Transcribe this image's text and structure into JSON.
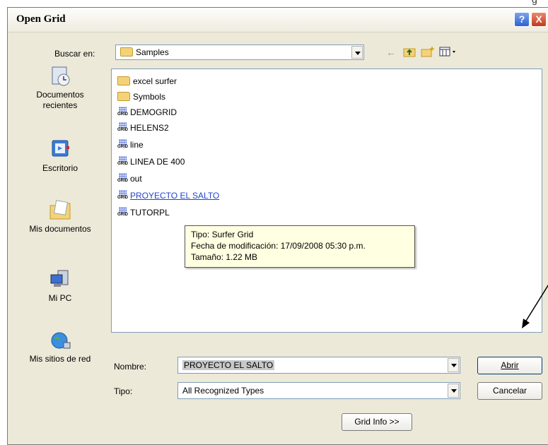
{
  "page_corner_text": "g",
  "window": {
    "title": "Open Grid",
    "help_label": "?",
    "close_label": "X"
  },
  "look_in": {
    "label": "Buscar en:",
    "value": "Samples"
  },
  "toolbar": {
    "icons": [
      "back-arrow-icon",
      "up-folder-icon",
      "new-folder-icon",
      "view-menu-icon"
    ]
  },
  "places": [
    {
      "label": "Documentos recientes",
      "icon": "recent-documents-icon"
    },
    {
      "label": "Escritorio",
      "icon": "desktop-icon"
    },
    {
      "label": "Mis documentos",
      "icon": "my-documents-icon"
    },
    {
      "label": "Mi PC",
      "icon": "my-computer-icon"
    },
    {
      "label": "Mis sitios de red",
      "icon": "network-places-icon"
    }
  ],
  "files": [
    {
      "name": "excel surfer",
      "type": "folder"
    },
    {
      "name": "Symbols",
      "type": "folder"
    },
    {
      "name": "DEMOGRID",
      "type": "grid"
    },
    {
      "name": "HELENS2",
      "type": "grid"
    },
    {
      "name": "line",
      "type": "grid"
    },
    {
      "name": "LINEA DE 400",
      "type": "grid"
    },
    {
      "name": "out",
      "type": "grid"
    },
    {
      "name": "PROYECTO EL SALTO",
      "type": "grid",
      "selected": true
    },
    {
      "name": "TUTORPL",
      "type": "grid"
    }
  ],
  "grid_icon_text": "GRID",
  "tooltip": {
    "line1": "Tipo: Surfer Grid",
    "line2": "Fecha de modificación: 17/09/2008 05:30 p.m.",
    "line3": "Tamaño: 1.22 MB"
  },
  "filename": {
    "label": "Nombre:",
    "value": "PROYECTO EL SALTO"
  },
  "filetype": {
    "label": "Tipo:",
    "value": "All Recognized Types"
  },
  "buttons": {
    "open": "Abrir",
    "cancel": "Cancelar",
    "grid_info": "Grid Info >>"
  },
  "colors": {
    "dialog_bg": "#ece9d8",
    "selected_text": "#2244cc",
    "tooltip_bg": "#ffffe1"
  }
}
